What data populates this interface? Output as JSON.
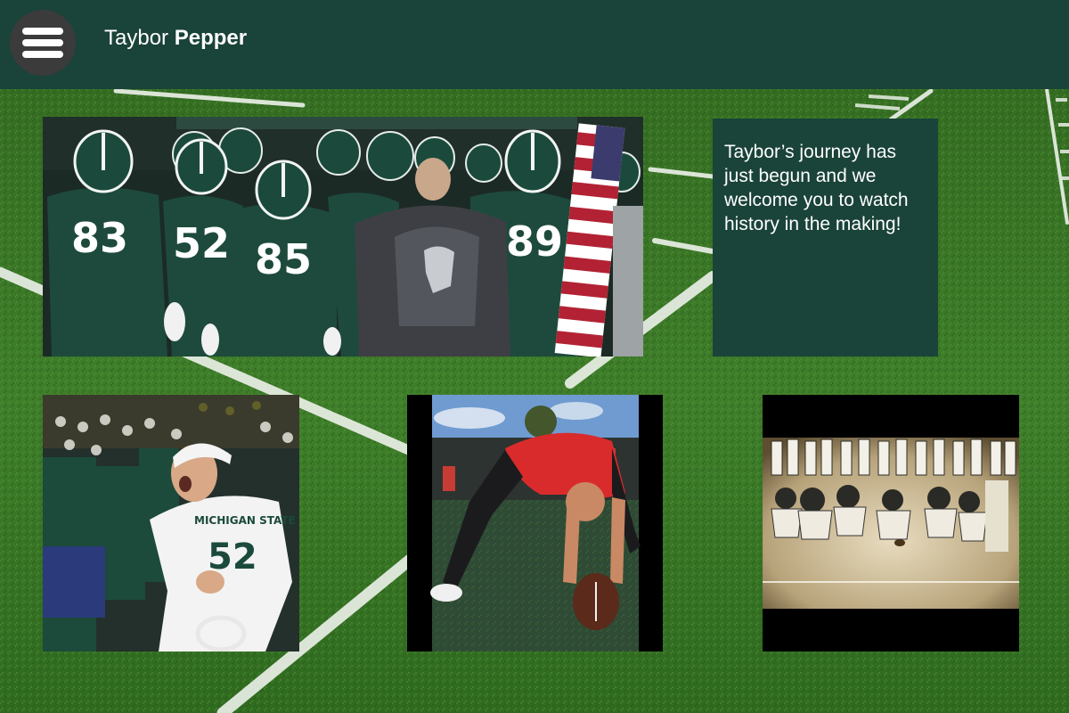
{
  "header": {
    "title_first": "Taybor",
    "title_last": "Pepper"
  },
  "intro": {
    "text": "Taybor’s journey has just begun and we welcome you to watch history in the making!"
  },
  "jerseys": {
    "player_1": "83",
    "player_2": "52",
    "player_3": "85",
    "player_4": "89",
    "celebrating_player": "52",
    "chest_text": "MICHIGAN STATE"
  },
  "colors": {
    "header": "#1a4339",
    "intro_box": "#1a4339",
    "menu_button": "#3b3b3b",
    "field_green": "#3f7a2b",
    "spartan_green": "#18453b"
  },
  "icons": {
    "menu": "hamburger-menu-icon"
  }
}
